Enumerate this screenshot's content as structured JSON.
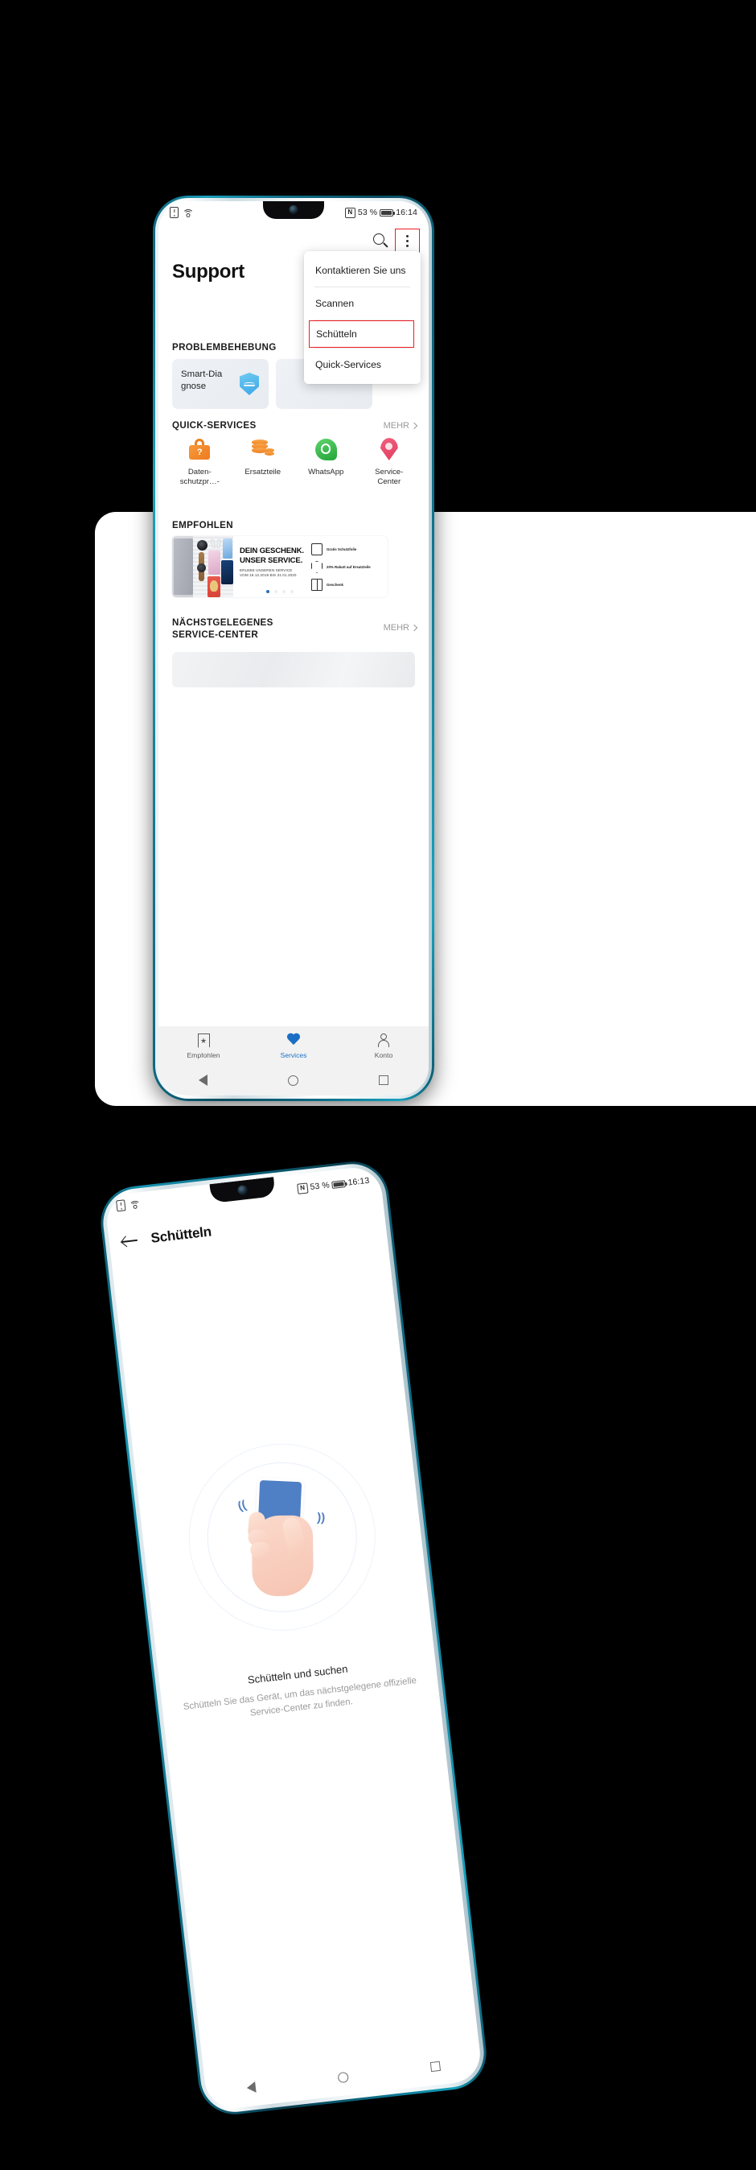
{
  "phone1": {
    "status_bar": {
      "sim_icon": "sim-card-icon",
      "wifi_icon": "wifi-icon",
      "nfc_icon": "nfc-icon",
      "nfc_label": "N",
      "battery_percent": "53 %",
      "battery_icon": "battery-icon",
      "time": "16:14"
    },
    "header": {
      "search_icon": "search-icon",
      "overflow_icon": "kebab-menu-icon",
      "title": "Support"
    },
    "menu": {
      "items": [
        {
          "label": "Kontaktieren Sie uns",
          "highlighted": false
        },
        {
          "label": "Scannen",
          "highlighted": false
        },
        {
          "label": "Schütteln",
          "highlighted": true
        },
        {
          "label": "Quick-Services",
          "highlighted": false
        }
      ]
    },
    "troubleshooting": {
      "heading": "PROBLEMBEHEBUNG",
      "card_title": "Smart-Dia\ngnose",
      "card_title_l1": "Smart-Dia",
      "card_title_l2": "gnose",
      "card_icon": "shield-pulse-icon"
    },
    "quick_services": {
      "heading": "QUICK-SERVICES",
      "more_label": "MEHR",
      "items": [
        {
          "label_l1": "Daten-",
          "label_l2": "schutzpr…-",
          "icon": "lock-question-icon"
        },
        {
          "label_l1": "Ersatzteile",
          "label_l2": "",
          "icon": "coins-icon"
        },
        {
          "label_l1": "WhatsApp",
          "label_l2": "",
          "icon": "whatsapp-icon"
        },
        {
          "label_l1": "Service-",
          "label_l2": "Center",
          "icon": "map-pin-icon"
        }
      ]
    },
    "recommended": {
      "heading": "EMPFOHLEN",
      "banner": {
        "title_l1": "DEIN GESCHENK.",
        "title_l2": "UNSER SERVICE.",
        "sub_l1": "ERLEBE UNSEREN SERVICE",
        "sub_l2": "VOM 16.12.2019 BIS 31.01.2020",
        "perks": [
          {
            "label": "Gratis Schutzfolie",
            "icon": "phone-film-icon"
          },
          {
            "label": "20% Rabatt auf Ersatzteile",
            "icon": "shield-wrench-icon"
          },
          {
            "label": "Geschenk",
            "icon": "gift-icon"
          }
        ],
        "dots": 4,
        "active_dot": 0
      }
    },
    "nearest_center": {
      "heading_l1": "NÄCHSTGELEGENES",
      "heading_l2": "SERVICE-CENTER",
      "more_label": "MEHR"
    },
    "bottom_nav": {
      "items": [
        {
          "label": "Empfohlen",
          "icon": "bookmark-star-icon",
          "active": false
        },
        {
          "label": "Services",
          "icon": "heart-icon",
          "active": true
        },
        {
          "label": "Konto",
          "icon": "person-icon",
          "active": false
        }
      ],
      "active_color": "#1a73c8"
    },
    "system_nav": {
      "back_icon": "back-triangle-icon",
      "home_icon": "home-circle-icon",
      "recents_icon": "recents-square-icon"
    }
  },
  "phone2": {
    "status_bar": {
      "sim_icon": "sim-card-icon",
      "wifi_icon": "wifi-icon",
      "nfc_icon": "nfc-icon",
      "nfc_label": "N",
      "battery_percent": "53 %",
      "battery_icon": "battery-icon",
      "time": "16:13"
    },
    "header": {
      "back_icon": "back-arrow-icon",
      "title": "Schütteln"
    },
    "illustration": {
      "name": "hand-shaking-phone-illustration",
      "wave_left": "((",
      "wave_right": "))"
    },
    "body": {
      "title": "Schütteln und suchen",
      "description": "Schütteln Sie das Gerät, um das nächstgelegene offizielle Service-Center zu finden."
    },
    "system_nav": {
      "back_icon": "back-triangle-icon",
      "home_icon": "home-circle-icon",
      "recents_icon": "recents-square-icon"
    }
  },
  "colors": {
    "highlight_box": "#ee1b22",
    "accent_blue": "#1a73c8",
    "background": "#000000"
  }
}
